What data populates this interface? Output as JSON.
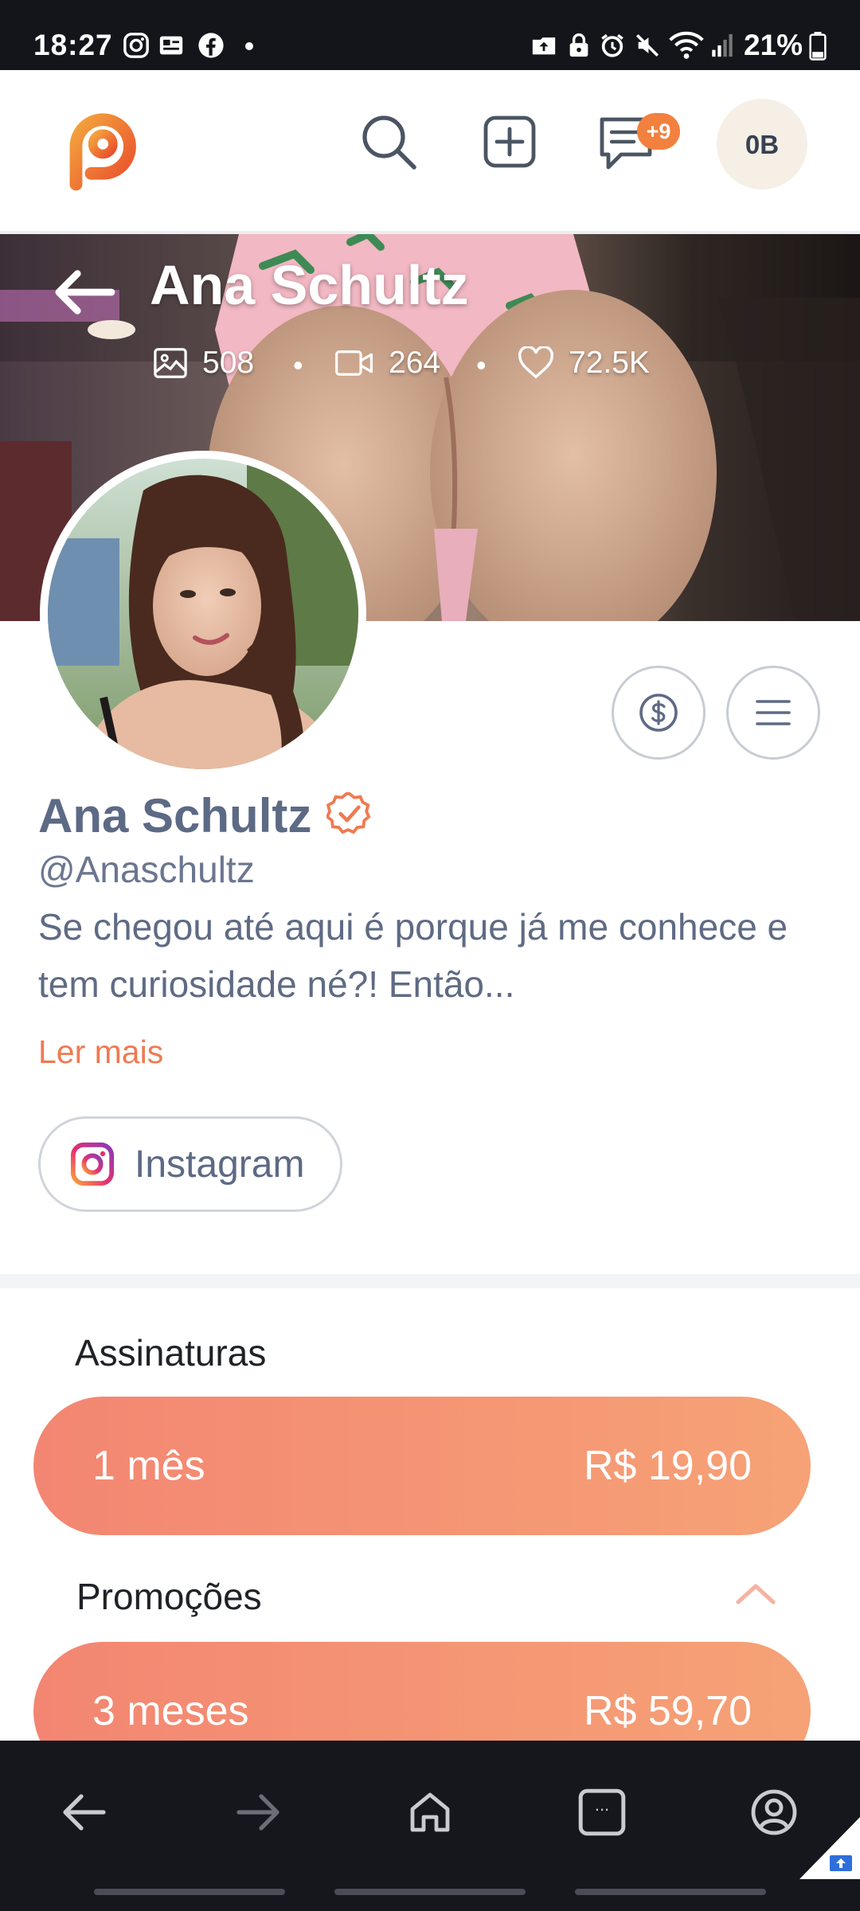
{
  "status_bar": {
    "time": "18:27",
    "battery": "21%",
    "left_icons": [
      "instagram-icon",
      "photo-icon",
      "facebook-icon",
      "dot-icon"
    ],
    "right_icons": [
      "upload-icon",
      "lock-icon",
      "alarm-icon",
      "mute-icon",
      "wifi-icon",
      "signal-icon",
      "battery-icon"
    ]
  },
  "header": {
    "logo_icon": "brand-logo-icon",
    "search_icon": "search-icon",
    "add_icon": "add-post-icon",
    "messages_icon": "messages-icon",
    "messages_badge": "+9",
    "avatar_initials": "0B",
    "accent": "#f2803f"
  },
  "cover": {
    "back_icon": "back-arrow-icon",
    "title": "Ana Schultz",
    "stats": {
      "photos": "508",
      "videos": "264",
      "likes": "72.5K",
      "separator": "•"
    }
  },
  "profile": {
    "name": "Ana Schultz",
    "verified_icon": "verified-badge-icon",
    "handle": "@Anaschultz",
    "bio": "Se chegou até aqui é porque já me conhece e tem curiosidade né?! Então...",
    "read_more": "Ler mais",
    "tip_icon": "dollar-icon",
    "menu_icon": "menu-icon",
    "social": {
      "label": "Instagram",
      "icon": "instagram-icon"
    }
  },
  "subscriptions": {
    "title": "Assinaturas",
    "plans": [
      {
        "duration": "1 mês",
        "price": "R$ 19,90"
      }
    ]
  },
  "promotions": {
    "title": "Promoções",
    "toggle_icon": "chevron-up-icon",
    "plans": [
      {
        "duration": "3 meses",
        "price": "R$ 59,70"
      }
    ]
  },
  "bottom_nav": {
    "icons": [
      "nav-back-icon",
      "nav-forward-icon",
      "home-icon",
      "tabs-icon",
      "account-icon"
    ],
    "tabs_label": "..."
  }
}
